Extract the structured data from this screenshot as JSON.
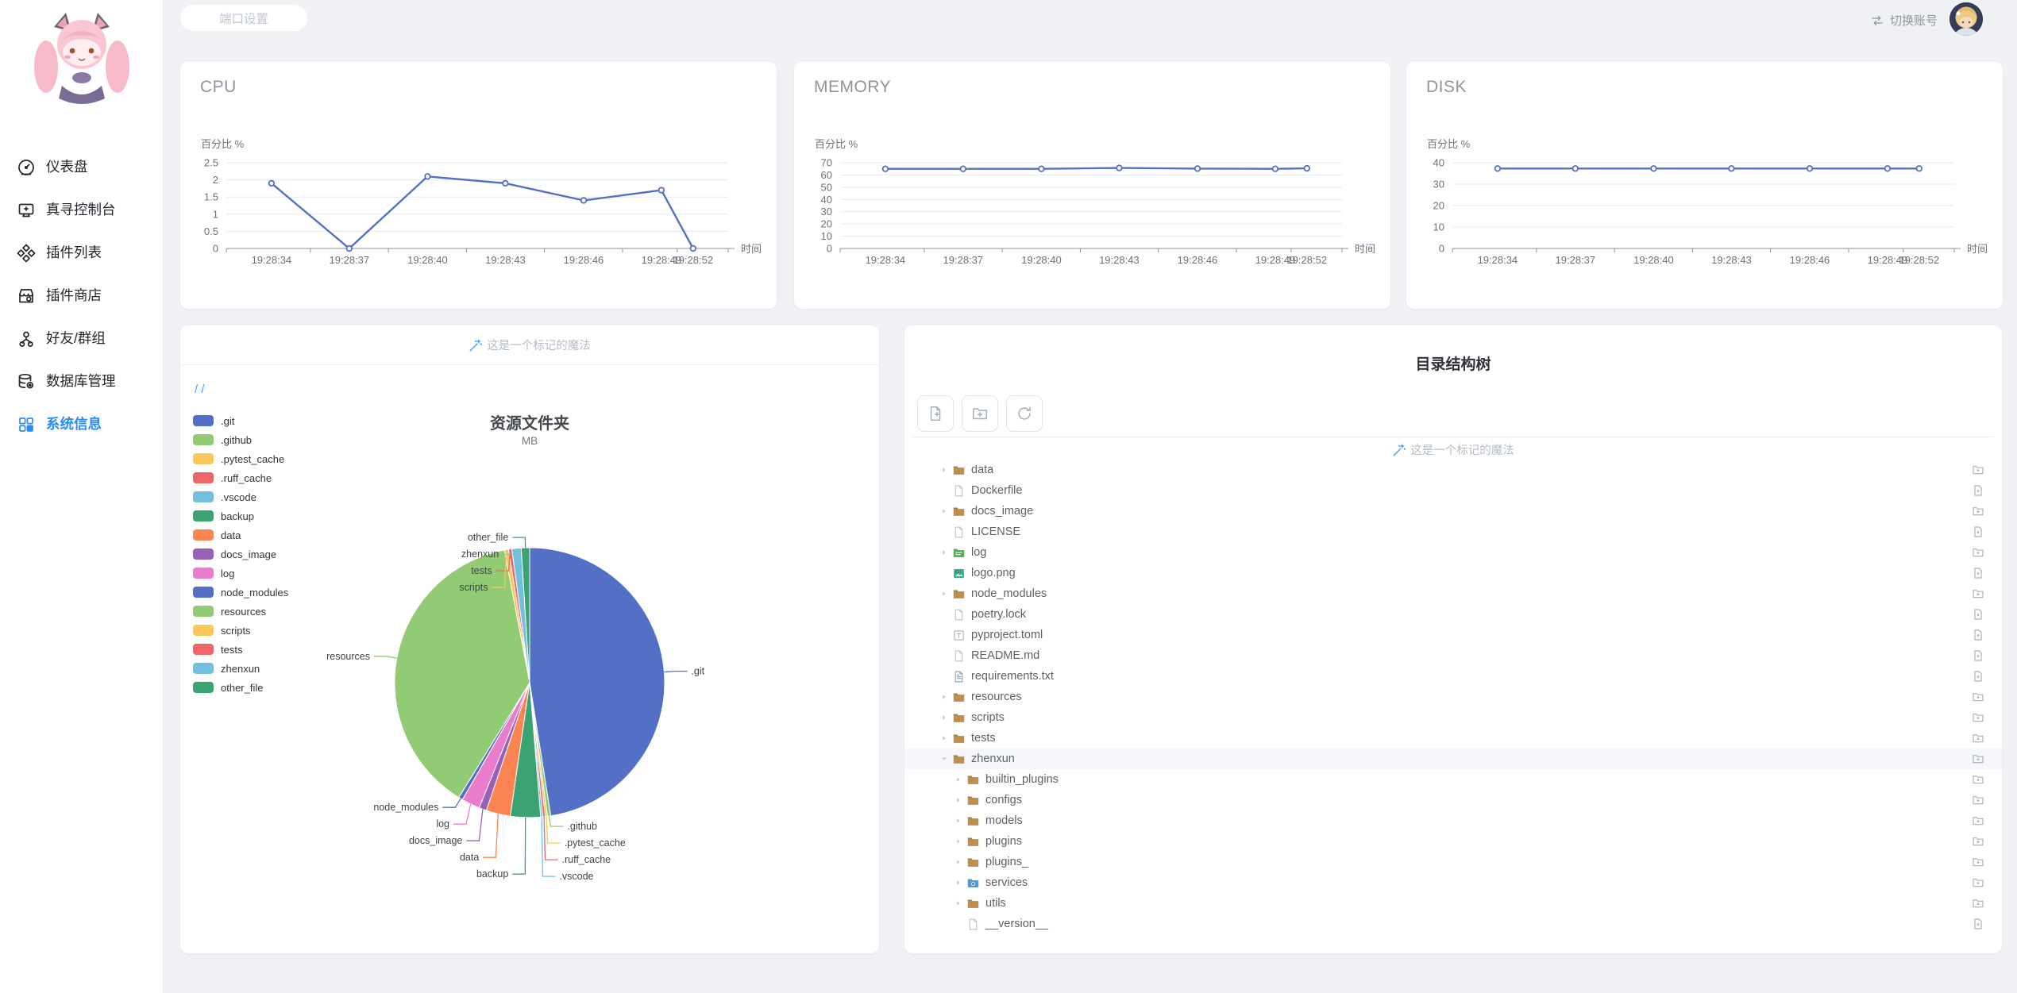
{
  "topbar": {
    "port_button_label": "端口设置",
    "switch_account_label": "切换账号"
  },
  "sidebar": {
    "items": [
      {
        "id": "dashboard",
        "label": "仪表盘",
        "icon": "gauge-icon",
        "active": false
      },
      {
        "id": "console",
        "label": "真寻控制台",
        "icon": "console-icon",
        "active": false
      },
      {
        "id": "plugin-list",
        "label": "插件列表",
        "icon": "plugin-list-icon",
        "active": false
      },
      {
        "id": "plugin-store",
        "label": "插件商店",
        "icon": "plugin-store-icon",
        "active": false
      },
      {
        "id": "friends-groups",
        "label": "好友/群组",
        "icon": "friends-groups-icon",
        "active": false
      },
      {
        "id": "database",
        "label": "数据库管理",
        "icon": "database-icon",
        "active": false
      },
      {
        "id": "system-info",
        "label": "系统信息",
        "icon": "system-info-icon",
        "active": true
      }
    ]
  },
  "magic_badge_text": "这是一个标记的魔法",
  "resource_card": {
    "breadcrumb": "/ /",
    "title": "资源文件夹",
    "subtitle": "MB"
  },
  "tree_card": {
    "title": "目录结构树",
    "toolbar": [
      {
        "icon": "new-file-icon"
      },
      {
        "icon": "new-folder-icon"
      },
      {
        "icon": "refresh-icon"
      }
    ],
    "rows": [
      {
        "label": "data",
        "depth": 0,
        "icon": "folder",
        "arrow": "collapsed",
        "action": "folder"
      },
      {
        "label": "Dockerfile",
        "depth": 0,
        "icon": "file",
        "arrow": null,
        "action": "file"
      },
      {
        "label": "docs_image",
        "depth": 0,
        "icon": "folder",
        "arrow": "collapsed",
        "action": "folder"
      },
      {
        "label": "LICENSE",
        "depth": 0,
        "icon": "file",
        "arrow": null,
        "action": "file"
      },
      {
        "label": "log",
        "depth": 0,
        "icon": "folder-log",
        "arrow": "collapsed",
        "action": "folder"
      },
      {
        "label": "logo.png",
        "depth": 0,
        "icon": "image-file",
        "arrow": null,
        "action": "file"
      },
      {
        "label": "node_modules",
        "depth": 0,
        "icon": "folder",
        "arrow": "collapsed",
        "action": "folder"
      },
      {
        "label": "poetry.lock",
        "depth": 0,
        "icon": "file",
        "arrow": null,
        "action": "file"
      },
      {
        "label": "pyproject.toml",
        "depth": 0,
        "icon": "toml-file",
        "arrow": null,
        "action": "file"
      },
      {
        "label": "README.md",
        "depth": 0,
        "icon": "file",
        "arrow": null,
        "action": "file"
      },
      {
        "label": "requirements.txt",
        "depth": 0,
        "icon": "text-file",
        "arrow": null,
        "action": "file"
      },
      {
        "label": "resources",
        "depth": 0,
        "icon": "folder",
        "arrow": "collapsed",
        "action": "folder"
      },
      {
        "label": "scripts",
        "depth": 0,
        "icon": "folder",
        "arrow": "collapsed",
        "action": "folder"
      },
      {
        "label": "tests",
        "depth": 0,
        "icon": "folder",
        "arrow": "collapsed",
        "action": "folder"
      },
      {
        "label": "zhenxun",
        "depth": 0,
        "icon": "folder",
        "arrow": "expanded",
        "action": "folder",
        "highlighted": true
      },
      {
        "label": "builtin_plugins",
        "depth": 1,
        "icon": "folder",
        "arrow": "collapsed",
        "action": "folder"
      },
      {
        "label": "configs",
        "depth": 1,
        "icon": "folder",
        "arrow": "collapsed",
        "action": "folder"
      },
      {
        "label": "models",
        "depth": 1,
        "icon": "folder",
        "arrow": "collapsed",
        "action": "folder"
      },
      {
        "label": "plugins",
        "depth": 1,
        "icon": "folder",
        "arrow": "collapsed",
        "action": "folder"
      },
      {
        "label": "plugins_",
        "depth": 1,
        "icon": "folder",
        "arrow": "collapsed",
        "action": "folder"
      },
      {
        "label": "services",
        "depth": 1,
        "icon": "services-folder",
        "arrow": "collapsed",
        "action": "folder"
      },
      {
        "label": "utils",
        "depth": 1,
        "icon": "folder",
        "arrow": "collapsed",
        "action": "folder"
      },
      {
        "label": "__version__",
        "depth": 1,
        "icon": "file",
        "arrow": null,
        "action": "file"
      }
    ]
  },
  "chart_data": [
    {
      "id": "cpu",
      "type": "line",
      "card_title": "CPU",
      "ylabel": "百分比 %",
      "xlabel": "时间",
      "x": [
        "19:28:34",
        "19:28:37",
        "19:28:40",
        "19:28:43",
        "19:28:46",
        "19:28:49",
        "19:28:52"
      ],
      "values": [
        1.9,
        0,
        2.1,
        1.9,
        1.4,
        1.7,
        0
      ],
      "ylim": [
        0,
        2.5
      ],
      "yticks": [
        0,
        0.5,
        1,
        1.5,
        2,
        2.5
      ],
      "x_fracs": [
        0.09,
        0.245,
        0.401,
        0.556,
        0.712,
        0.867,
        0.93
      ],
      "line_color": "#5470c6",
      "grid": true
    },
    {
      "id": "memory",
      "type": "line",
      "card_title": "MEMORY",
      "ylabel": "百分比 %",
      "xlabel": "时间",
      "x": [
        "19:28:34",
        "19:28:37",
        "19:28:40",
        "19:28:43",
        "19:28:46",
        "19:28:49",
        "19:28:52"
      ],
      "values": [
        65,
        65,
        65,
        65.7,
        65.2,
        65,
        65.4
      ],
      "ylim": [
        0,
        70
      ],
      "yticks": [
        0,
        10,
        20,
        30,
        40,
        50,
        60,
        70
      ],
      "x_fracs": [
        0.09,
        0.245,
        0.401,
        0.556,
        0.712,
        0.867,
        0.93
      ],
      "line_color": "#5470c6",
      "grid": true
    },
    {
      "id": "disk",
      "type": "line",
      "card_title": "DISK",
      "ylabel": "百分比 %",
      "xlabel": "时间",
      "x": [
        "19:28:34",
        "19:28:37",
        "19:28:40",
        "19:28:43",
        "19:28:46",
        "19:28:49",
        "19:28:52"
      ],
      "values": [
        37.3,
        37.3,
        37.3,
        37.3,
        37.3,
        37.3,
        37.3
      ],
      "ylim": [
        0,
        40
      ],
      "yticks": [
        0,
        10,
        20,
        30,
        40
      ],
      "x_fracs": [
        0.09,
        0.245,
        0.401,
        0.556,
        0.712,
        0.867,
        0.93
      ],
      "line_color": "#5470c6",
      "grid": true
    },
    {
      "id": "resource-folders",
      "type": "pie",
      "title": "资源文件夹",
      "subtitle": "MB",
      "legend_position": "left",
      "slices": [
        {
          "name": ".git",
          "percent": 47.5
        },
        {
          "name": ".github",
          "percent": 0.4
        },
        {
          "name": ".pytest_cache",
          "percent": 0.25
        },
        {
          "name": ".ruff_cache",
          "percent": 0.3
        },
        {
          "name": ".vscode",
          "percent": 0.25
        },
        {
          "name": "backup",
          "percent": 3.6
        },
        {
          "name": "data",
          "percent": 2.9
        },
        {
          "name": "docs_image",
          "percent": 0.9
        },
        {
          "name": "log",
          "percent": 2.2
        },
        {
          "name": "node_modules",
          "percent": 0.5
        },
        {
          "name": "resources",
          "percent": 38.2
        },
        {
          "name": "scripts",
          "percent": 0.5
        },
        {
          "name": "tests",
          "percent": 0.4
        },
        {
          "name": "zhenxun",
          "percent": 1.1
        },
        {
          "name": "other_file",
          "percent": 1.0
        }
      ],
      "colors": [
        "#5470c6",
        "#91cc75",
        "#fac858",
        "#ee6666",
        "#73c0de",
        "#3ba272",
        "#fc8452",
        "#9a60b4",
        "#ea7ccc"
      ]
    }
  ]
}
